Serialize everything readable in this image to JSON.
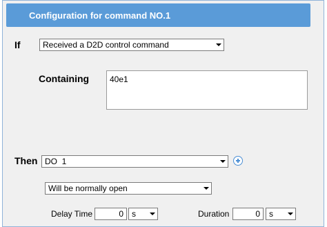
{
  "header": {
    "title": "Configuration for command NO.1"
  },
  "if_section": {
    "label": "If",
    "condition_value": "Received a D2D control command",
    "containing_label": "Containing",
    "containing_value": "40e1"
  },
  "then_section": {
    "label": "Then",
    "target_value": "DO  1",
    "action_value": "Will be normally open",
    "add_icon": "plus-circle-icon"
  },
  "timing": {
    "delay_label": "Delay Time",
    "delay_value": "0",
    "delay_unit": "s",
    "duration_label": "Duration",
    "duration_value": "0",
    "duration_unit": "s"
  },
  "colors": {
    "title_bar": "#5a9bd8",
    "panel_bg": "#f0f0f0",
    "add_icon": "#4a8ed4"
  }
}
